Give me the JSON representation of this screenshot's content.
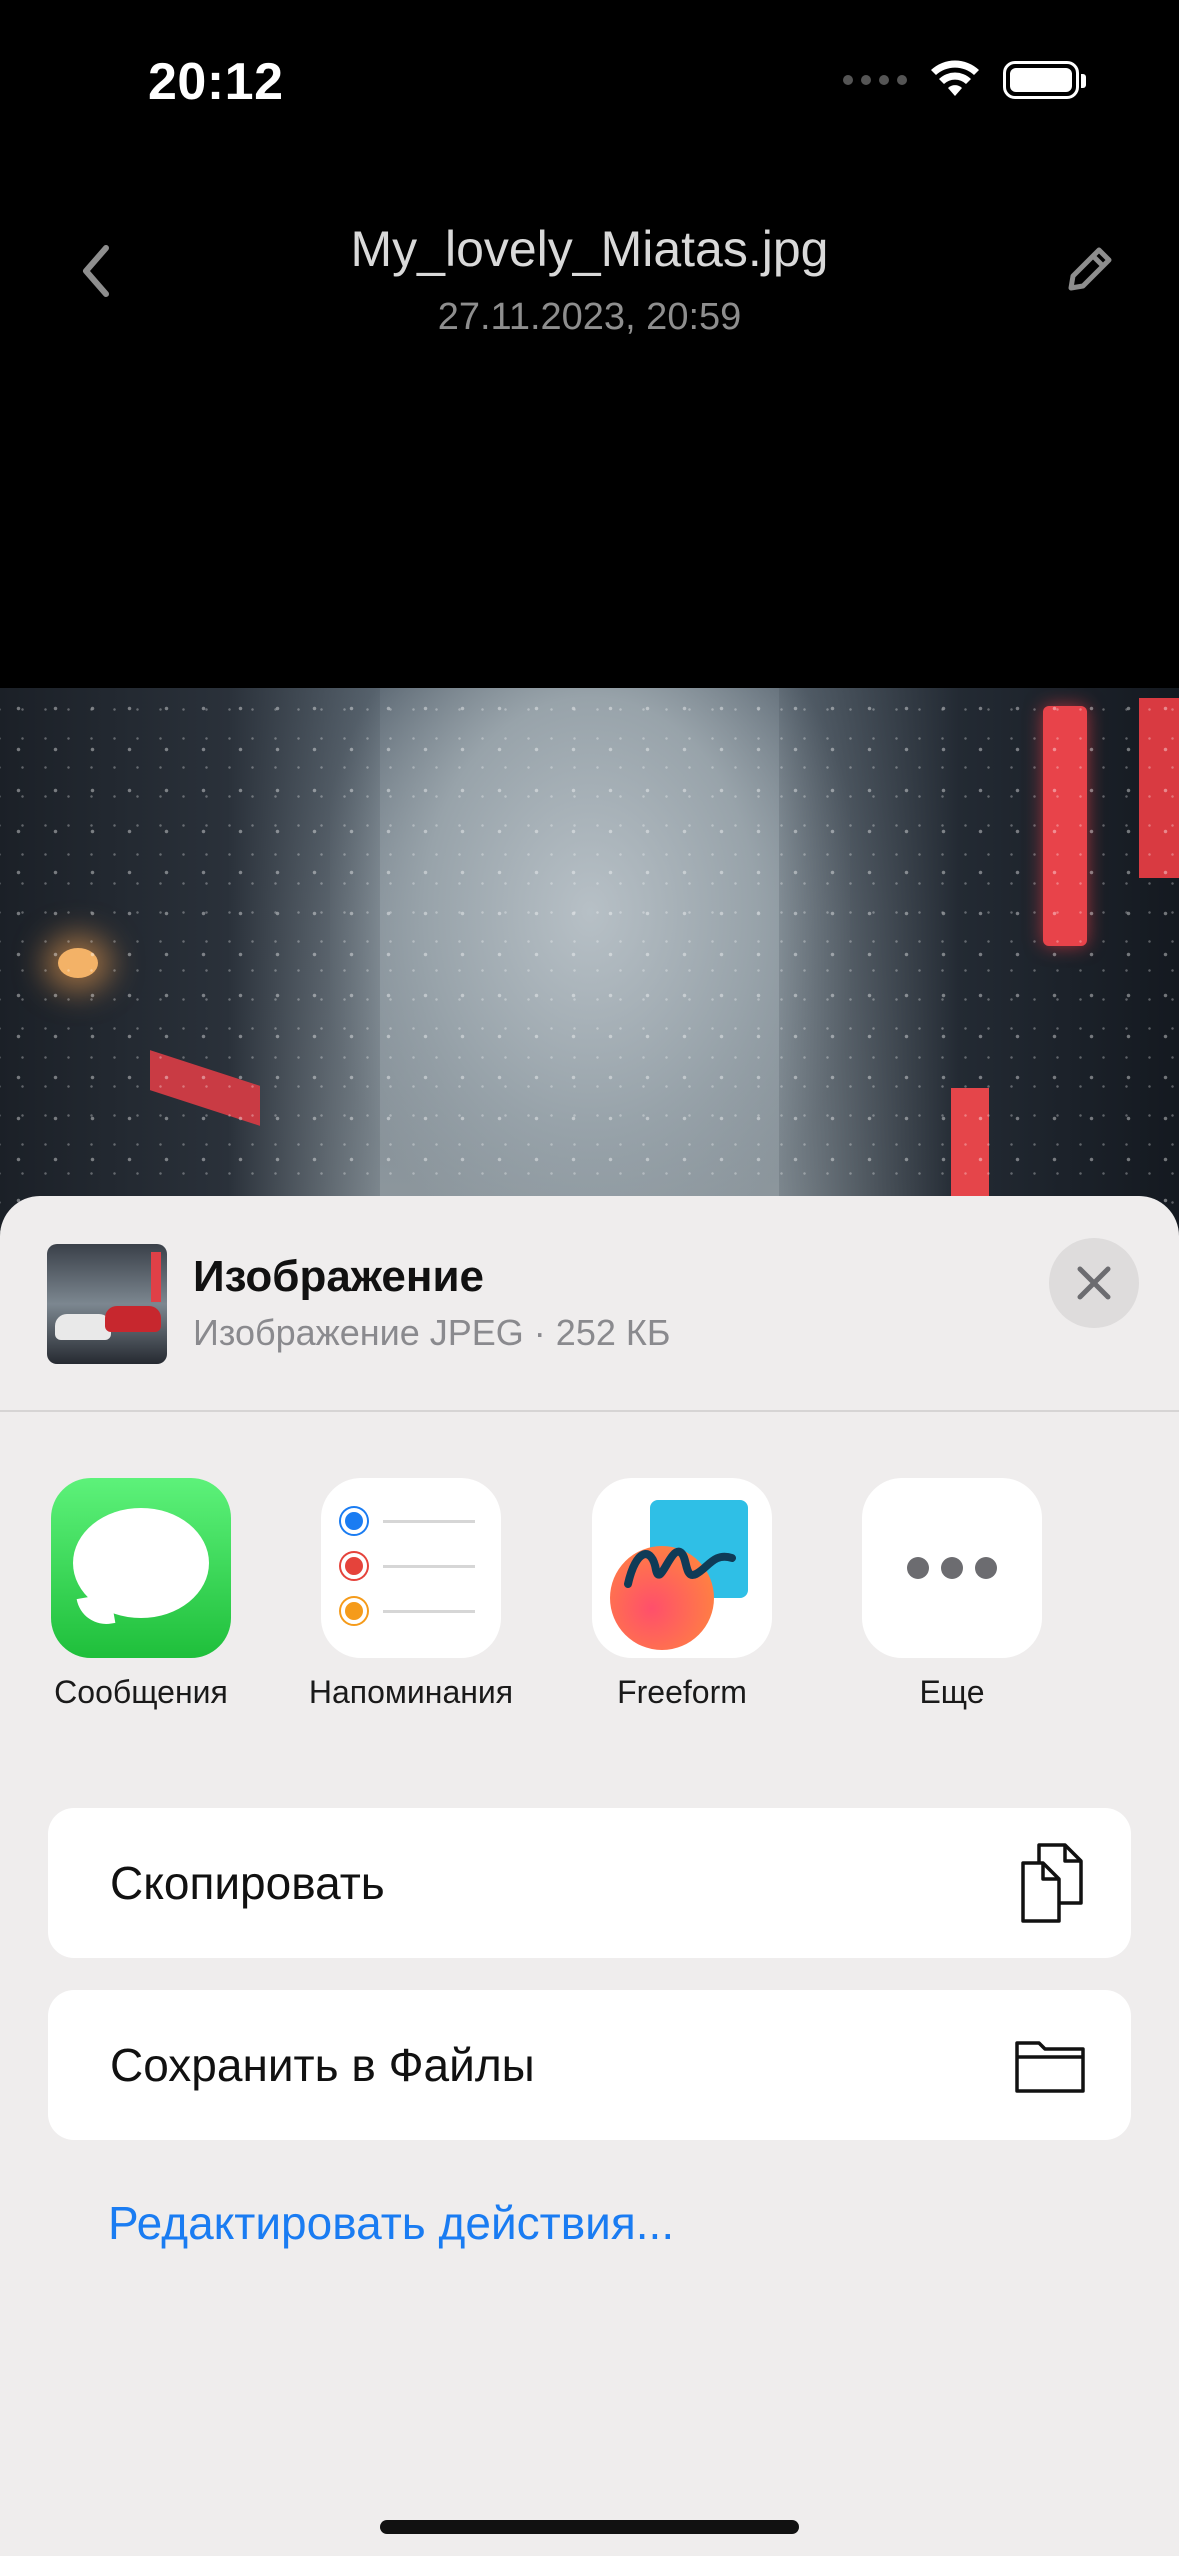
{
  "status_bar": {
    "time": "20:12"
  },
  "header": {
    "file_name": "My_lovely_Miatas.jpg",
    "date": "27.11.2023, 20:59"
  },
  "share_sheet": {
    "title": "Изображение",
    "subtitle": "Изображение JPEG · 252 КБ",
    "apps": [
      {
        "label": "Сообщения",
        "icon": "messages-icon"
      },
      {
        "label": "Напоминания",
        "icon": "reminders-icon"
      },
      {
        "label": "Freeform",
        "icon": "freeform-icon"
      },
      {
        "label": "Еще",
        "icon": "more-icon"
      }
    ],
    "actions": [
      {
        "label": "Скопировать",
        "icon": "copy-icon"
      },
      {
        "label": "Сохранить в Файлы",
        "icon": "folder-icon"
      }
    ],
    "edit_actions": "Редактировать действия..."
  },
  "colors": {
    "accent": "#1a7cf2",
    "messages_green": "#1fbf3b",
    "reminder_blue": "#1a7cf2",
    "reminder_red": "#e5433b",
    "reminder_orange": "#f59b1a"
  }
}
